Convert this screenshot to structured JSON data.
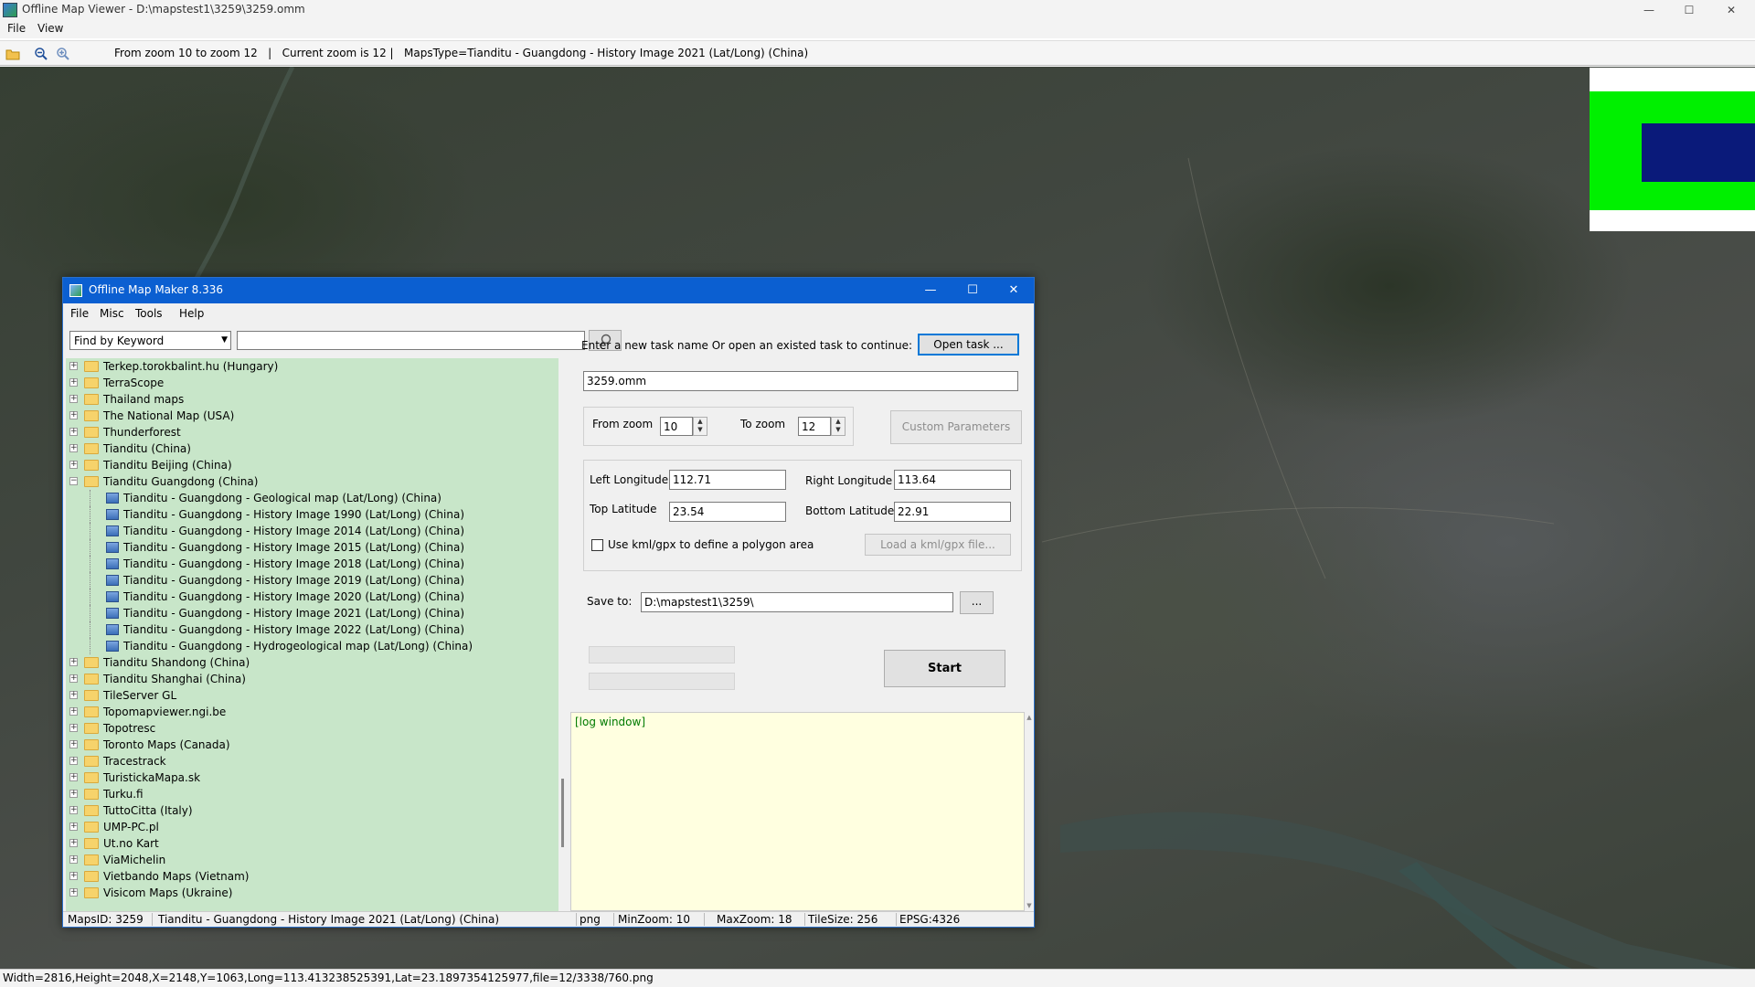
{
  "window": {
    "title": "Offline Map Viewer - D:\\mapstest1\\3259\\3259.omm",
    "controls": {
      "minimize": "—",
      "maximize": "☐",
      "close": "✕"
    }
  },
  "menu": {
    "file": "File",
    "view": "View"
  },
  "toolbar": {
    "info": "From zoom 10 to zoom 12   |   Current zoom is 12 |   MapsType=Tianditu - Guangdong - History Image 2021 (Lat/Long) (China)",
    "icons": [
      "open-folder-icon",
      "zoom-out-icon",
      "zoom-in-icon"
    ]
  },
  "overview_colors": {
    "frame": "#00f000",
    "viewport": "#0a1a7a"
  },
  "statusbar": {
    "text": "Width=2816,Height=2048,X=2148,Y=1063,Long=113.413238525391,Lat=23.1897354125977,file=12/3338/760.png"
  },
  "dialog": {
    "title": "Offline Map Maker 8.336",
    "controls": {
      "minimize": "—",
      "maximize": "☐",
      "close": "✕"
    },
    "menu": {
      "file": "File",
      "misc": "Misc",
      "tools": "Tools",
      "help": "Help"
    },
    "find": {
      "mode": "Find by Keyword",
      "query": "",
      "search_icon": "magnifier-icon"
    },
    "tree": [
      {
        "label": "Terkep.torokbalint.hu (Hungary)",
        "level": 0,
        "expanded": false
      },
      {
        "label": "TerraScope",
        "level": 0,
        "expanded": false
      },
      {
        "label": "Thailand maps",
        "level": 0,
        "expanded": false
      },
      {
        "label": "The National Map (USA)",
        "level": 0,
        "expanded": false
      },
      {
        "label": "Thunderforest",
        "level": 0,
        "expanded": false
      },
      {
        "label": "Tianditu (China)",
        "level": 0,
        "expanded": false
      },
      {
        "label": "Tianditu Beijing (China)",
        "level": 0,
        "expanded": false
      },
      {
        "label": "Tianditu Guangdong (China)",
        "level": 0,
        "expanded": true
      },
      {
        "label": "Tianditu - Guangdong - Geological map (Lat/Long) (China)",
        "level": 1
      },
      {
        "label": "Tianditu - Guangdong - History Image 1990 (Lat/Long) (China)",
        "level": 1
      },
      {
        "label": "Tianditu - Guangdong - History Image 2014 (Lat/Long) (China)",
        "level": 1
      },
      {
        "label": "Tianditu - Guangdong - History Image 2015 (Lat/Long) (China)",
        "level": 1
      },
      {
        "label": "Tianditu - Guangdong - History Image 2018 (Lat/Long) (China)",
        "level": 1
      },
      {
        "label": "Tianditu - Guangdong - History Image 2019 (Lat/Long) (China)",
        "level": 1
      },
      {
        "label": "Tianditu - Guangdong - History Image 2020 (Lat/Long) (China)",
        "level": 1
      },
      {
        "label": "Tianditu - Guangdong - History Image 2021 (Lat/Long) (China)",
        "level": 1
      },
      {
        "label": "Tianditu - Guangdong - History Image 2022 (Lat/Long) (China)",
        "level": 1
      },
      {
        "label": "Tianditu - Guangdong - Hydrogeological map (Lat/Long) (China)",
        "level": 1
      },
      {
        "label": "Tianditu Shandong (China)",
        "level": 0,
        "expanded": false
      },
      {
        "label": "Tianditu Shanghai (China)",
        "level": 0,
        "expanded": false
      },
      {
        "label": "TileServer GL",
        "level": 0,
        "expanded": false
      },
      {
        "label": "Topomapviewer.ngi.be",
        "level": 0,
        "expanded": false
      },
      {
        "label": "Topotresc",
        "level": 0,
        "expanded": false
      },
      {
        "label": "Toronto Maps (Canada)",
        "level": 0,
        "expanded": false
      },
      {
        "label": "Tracestrack",
        "level": 0,
        "expanded": false
      },
      {
        "label": "TuristickaMapa.sk",
        "level": 0,
        "expanded": false
      },
      {
        "label": "Turku.fi",
        "level": 0,
        "expanded": false
      },
      {
        "label": "TuttoCitta (Italy)",
        "level": 0,
        "expanded": false
      },
      {
        "label": "UMP-PC.pl",
        "level": 0,
        "expanded": false
      },
      {
        "label": "Ut.no Kart",
        "level": 0,
        "expanded": false
      },
      {
        "label": "ViaMichelin",
        "level": 0,
        "expanded": false
      },
      {
        "label": "Vietbando Maps (Vietnam)",
        "level": 0,
        "expanded": false
      },
      {
        "label": "Visicom Maps (Ukraine)",
        "level": 0,
        "expanded": false
      }
    ],
    "task": {
      "prompt": "Enter a new task name Or open an existed task to continue:",
      "open_button": "Open task ...",
      "name": "3259.omm"
    },
    "zoom": {
      "from_label": "From zoom",
      "from_value": "10",
      "to_label": "To zoom",
      "to_value": "12",
      "custom_button": "Custom Parameters"
    },
    "bounds": {
      "left_label": "Left Longitude",
      "left_value": "112.71",
      "right_label": "Right Longitude",
      "right_value": "113.64",
      "top_label": "Top Latitude",
      "top_value": "23.54",
      "bottom_label": "Bottom Latitude",
      "bottom_value": "22.91",
      "kml_checkbox": "Use kml/gpx to define a polygon area",
      "kml_checked": false,
      "load_button": "Load a kml/gpx file..."
    },
    "save": {
      "label": "Save to:",
      "path": "D:\\mapstest1\\3259\\",
      "browse": "..."
    },
    "start_button": "Start",
    "log": "[log window]",
    "status": {
      "maps_id": "MapsID:  3259",
      "maps_name": "Tianditu - Guangdong - History Image 2021 (Lat/Long) (China)",
      "format": "png",
      "min_zoom": "MinZoom: 10",
      "max_zoom": "MaxZoom: 18",
      "tile_size": "TileSize: 256",
      "epsg": "EPSG:4326"
    }
  }
}
